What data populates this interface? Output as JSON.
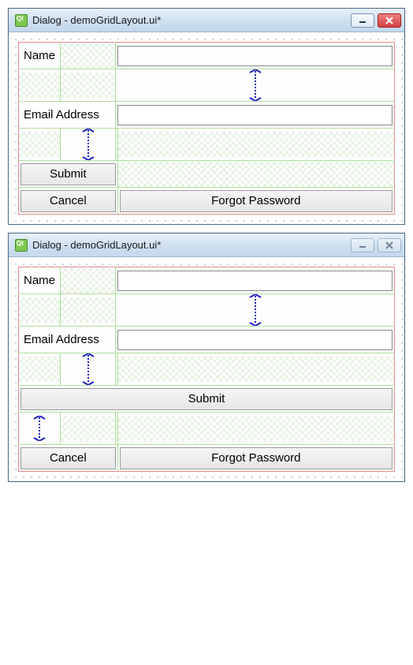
{
  "window1": {
    "title": "Dialog - demoGridLayout.ui*",
    "labels": {
      "name": "Name",
      "email": "Email Address"
    },
    "buttons": {
      "submit": "Submit",
      "cancel": "Cancel",
      "forgot": "Forgot Password"
    },
    "fields": {
      "name_value": "",
      "email_value": ""
    }
  },
  "window2": {
    "title": "Dialog - demoGridLayout.ui*",
    "labels": {
      "name": "Name",
      "email": "Email Address"
    },
    "buttons": {
      "submit": "Submit",
      "cancel": "Cancel",
      "forgot": "Forgot Password"
    },
    "fields": {
      "name_value": "",
      "email_value": ""
    }
  }
}
